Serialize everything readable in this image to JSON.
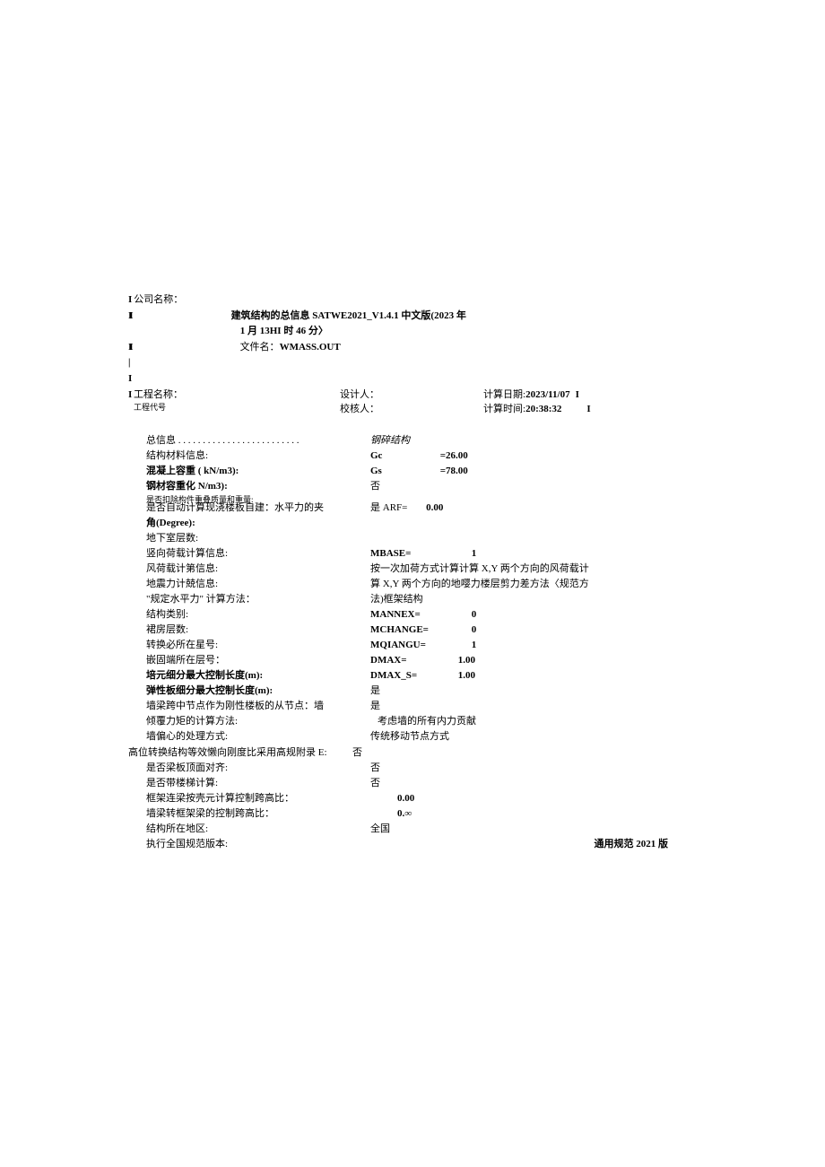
{
  "header": {
    "company_label": "公司名称：",
    "title_line1": "建筑结构的总信息 SATWE2021_V1.4.1 中文版(2023 年",
    "title_line2": "1 月 13HI 时 46 分〉",
    "filename_label": "文件名：",
    "filename": "WMASS.OUT",
    "project_label": "工程名称：",
    "designer_label": "设计人：",
    "calc_date_label": "计算日期:",
    "calc_date": "2023/11/07",
    "reviewer_label": "校核人：",
    "calc_time_label": "计算时间:",
    "calc_time": "20:38:32",
    "ext_line": "工程代号"
  },
  "info": {
    "section_title": "总信息 . . . . . . . . . . . . . . . . . . . . . . . . .",
    "rows": [
      {
        "label": "结构材料信息:",
        "value": "钢碎结构",
        "italic": true
      },
      {
        "label": "混凝上容重 ( kN/m3):",
        "code": "Gc",
        "eq": "=26.00"
      },
      {
        "label": "钢材容重化 N/m3):",
        "code": "Gs",
        "eq": "=78.00"
      },
      {
        "label": "是否扣除构件重叠质量和重量:",
        "value": "否",
        "small": true
      },
      {
        "label": "是否自动计算现浇楼板自建：水平力的夹",
        "value_prefix": "是 ARF=",
        "value": "0.00"
      },
      {
        "label": "角(Degree):",
        "value": ""
      },
      {
        "label": "地下室层数:",
        "value": ""
      },
      {
        "label": "竖向荷载计算信息:",
        "code": "MBASE=",
        "value": "1"
      },
      {
        "label": "风荷载计第信息:",
        "value": "按一次加荷方式计算计算 X,Y 两个方向的风荷载计"
      },
      {
        "label": "地震力计兢信息:",
        "value": "算 X,Y 两个方向的地嘤力楼层剪力差方法〈规范方"
      },
      {
        "label": "\"规定水平力\" 计算方法：",
        "value": "法)框架结构"
      },
      {
        "label": "结构类别:",
        "code": "MANNEX=",
        "value": "0"
      },
      {
        "label": "裙房层数:",
        "code": "MCHANGE=",
        "value": "0"
      },
      {
        "label": "转换必所在星号:",
        "code": "MQIANGU=",
        "value": "1"
      },
      {
        "label": "嵌固端所在层号：",
        "code": "DMAX=",
        "value": "1.00"
      },
      {
        "label": "培元细分最大控制长度(m):",
        "code": "DMAX_S=",
        "value": "1.00"
      },
      {
        "label": "弹性板细分最大控制长度(m):",
        "value": "是"
      },
      {
        "label": "墙梁跨中节点作为刚性楼板的从节点：墙",
        "value": "是"
      },
      {
        "label": "倾覆力矩的计算方法:",
        "value": "考虑墙的所有内力贡献"
      },
      {
        "label": "墙偏心的处理方式:",
        "value": "传统移动节点方式"
      },
      {
        "label": "高位转换结构等效懒向刚度比采用高规附录 E:",
        "value": "否",
        "noindent": true
      },
      {
        "label": "是否梁板顶面对齐:",
        "value": "否"
      },
      {
        "label": "是否带楼梯计算:",
        "value": "否"
      },
      {
        "label": "框架连梁按壳元计算控制跨高比：",
        "value": "0.00",
        "bold": true,
        "pad": true
      },
      {
        "label": "墙梁转框架梁的控制跨高比：",
        "value": "0.∞",
        "bold": true,
        "pad": true
      },
      {
        "label": "结构所在地区:",
        "value": "全国"
      }
    ],
    "last_label": "执行全国规范版本:",
    "last_value": "通用规范 2021 版"
  }
}
